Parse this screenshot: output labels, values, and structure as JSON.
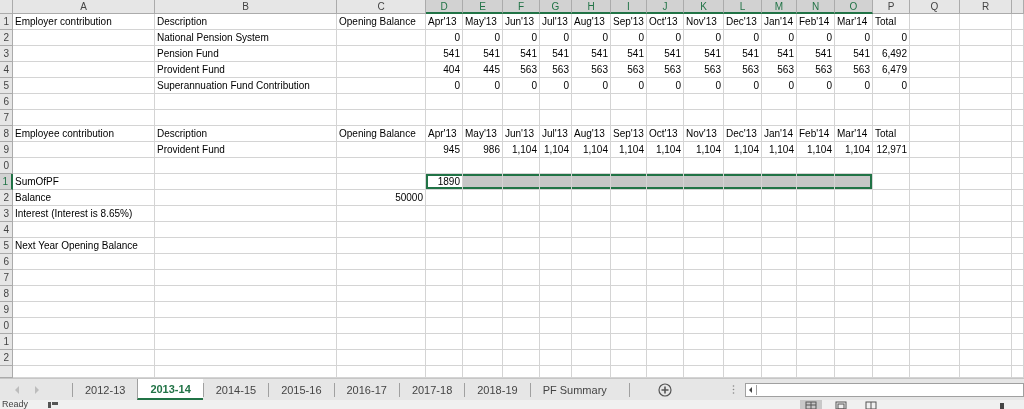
{
  "columns": [
    {
      "letter": "A",
      "selected": false
    },
    {
      "letter": "B",
      "selected": false
    },
    {
      "letter": "C",
      "selected": false
    },
    {
      "letter": "D",
      "selected": true
    },
    {
      "letter": "E",
      "selected": true
    },
    {
      "letter": "F",
      "selected": true
    },
    {
      "letter": "G",
      "selected": true
    },
    {
      "letter": "H",
      "selected": true
    },
    {
      "letter": "I",
      "selected": true
    },
    {
      "letter": "J",
      "selected": true
    },
    {
      "letter": "K",
      "selected": true
    },
    {
      "letter": "L",
      "selected": true
    },
    {
      "letter": "M",
      "selected": true
    },
    {
      "letter": "N",
      "selected": true
    },
    {
      "letter": "O",
      "selected": true
    },
    {
      "letter": "P",
      "selected": false
    },
    {
      "letter": "Q",
      "selected": false
    },
    {
      "letter": "R",
      "selected": false
    }
  ],
  "rows": [
    {
      "number": "1",
      "kind": "header",
      "selected": false,
      "cells": {
        "A": "Employer contribution",
        "B": "Description",
        "C": "Opening Balance",
        "D": "Apr'13",
        "E": "May'13",
        "F": "Jun'13",
        "G": "Jul'13",
        "H": "Aug'13",
        "I": "Sep'13",
        "J": "Oct'13",
        "K": "Nov'13",
        "L": "Dec'13",
        "M": "Jan'14",
        "N": "Feb'14",
        "O": "Mar'14",
        "P": "Total"
      }
    },
    {
      "number": "2",
      "kind": "data",
      "selected": false,
      "cells": {
        "B": "National Pension System",
        "D": "0",
        "E": "0",
        "F": "0",
        "G": "0",
        "H": "0",
        "I": "0",
        "J": "0",
        "K": "0",
        "L": "0",
        "M": "0",
        "N": "0",
        "O": "0",
        "P": "0"
      }
    },
    {
      "number": "3",
      "kind": "data",
      "selected": false,
      "cells": {
        "B": "Pension Fund",
        "D": "541",
        "E": "541",
        "F": "541",
        "G": "541",
        "H": "541",
        "I": "541",
        "J": "541",
        "K": "541",
        "L": "541",
        "M": "541",
        "N": "541",
        "O": "541",
        "P": "6,492"
      }
    },
    {
      "number": "4",
      "kind": "data",
      "selected": false,
      "cells": {
        "B": "Provident Fund",
        "D": "404",
        "E": "445",
        "F": "563",
        "G": "563",
        "H": "563",
        "I": "563",
        "J": "563",
        "K": "563",
        "L": "563",
        "M": "563",
        "N": "563",
        "O": "563",
        "P": "6,479"
      }
    },
    {
      "number": "5",
      "kind": "data",
      "selected": false,
      "cells": {
        "B": "Superannuation Fund Contribution",
        "D": "0",
        "E": "0",
        "F": "0",
        "G": "0",
        "H": "0",
        "I": "0",
        "J": "0",
        "K": "0",
        "L": "0",
        "M": "0",
        "N": "0",
        "O": "0",
        "P": "0"
      }
    },
    {
      "number": "6",
      "kind": "data",
      "selected": false,
      "cells": {}
    },
    {
      "number": "7",
      "kind": "data",
      "selected": false,
      "cells": {}
    },
    {
      "number": "8",
      "kind": "header",
      "selected": false,
      "cells": {
        "A": "Employee contribution",
        "B": "Description",
        "C": "Opening Balance",
        "D": "Apr'13",
        "E": "May'13",
        "F": "Jun'13",
        "G": "Jul'13",
        "H": "Aug'13",
        "I": "Sep'13",
        "J": "Oct'13",
        "K": "Nov'13",
        "L": "Dec'13",
        "M": "Jan'14",
        "N": "Feb'14",
        "O": "Mar'14",
        "P": "Total"
      }
    },
    {
      "number": "9",
      "kind": "data",
      "selected": false,
      "cells": {
        "B": "Provident Fund",
        "D": "945",
        "E": "986",
        "F": "1,104",
        "G": "1,104",
        "H": "1,104",
        "I": "1,104",
        "J": "1,104",
        "K": "1,104",
        "L": "1,104",
        "M": "1,104",
        "N": "1,104",
        "O": "1,104",
        "P": "12,971"
      }
    },
    {
      "number": "0",
      "kind": "data",
      "selected": false,
      "cells": {}
    },
    {
      "number": "1",
      "kind": "data",
      "selected": true,
      "cells": {
        "A": "SumOfPF",
        "D": "1890"
      }
    },
    {
      "number": "2",
      "kind": "data",
      "selected": false,
      "cells": {
        "A": "Balance",
        "C": "50000"
      }
    },
    {
      "number": "3",
      "kind": "data",
      "selected": false,
      "cells": {
        "A": "Interest (Interest is 8.65%)"
      }
    },
    {
      "number": "4",
      "kind": "data",
      "selected": false,
      "cells": {}
    },
    {
      "number": "5",
      "kind": "data",
      "selected": false,
      "cells": {
        "A": "Next Year Opening Balance"
      }
    },
    {
      "number": "6",
      "kind": "data",
      "selected": false,
      "cells": {}
    },
    {
      "number": "7",
      "kind": "data",
      "selected": false,
      "cells": {}
    },
    {
      "number": "8",
      "kind": "data",
      "selected": false,
      "cells": {}
    },
    {
      "number": "9",
      "kind": "data",
      "selected": false,
      "cells": {}
    },
    {
      "number": "0",
      "kind": "data",
      "selected": false,
      "cells": {}
    },
    {
      "number": "1",
      "kind": "data",
      "selected": false,
      "cells": {}
    },
    {
      "number": "2",
      "kind": "data",
      "selected": false,
      "cells": {}
    }
  ],
  "sheet_tabs": [
    {
      "label": "2012-13",
      "selected": false
    },
    {
      "label": "2013-14",
      "selected": true
    },
    {
      "label": "2014-15",
      "selected": false
    },
    {
      "label": "2015-16",
      "selected": false
    },
    {
      "label": "2016-17",
      "selected": false
    },
    {
      "label": "2017-18",
      "selected": false
    },
    {
      "label": "2018-19",
      "selected": false
    },
    {
      "label": "PF Summary",
      "selected": false
    }
  ],
  "status_bar": {
    "text": "Ready"
  }
}
